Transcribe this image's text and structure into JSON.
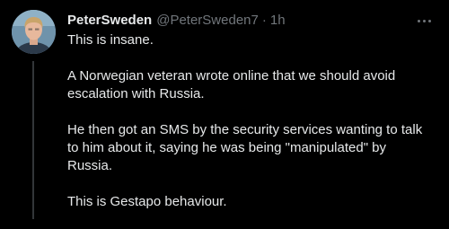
{
  "tweet": {
    "display_name": "PeterSweden",
    "handle": "@PeterSweden7",
    "separator": "·",
    "time": "1h",
    "avatar_icon": "avatar-photo",
    "more_icon": "more-horizontal-icon",
    "paragraphs": [
      "This is insane.",
      "A Norwegian veteran wrote online that we should avoid escalation with Russia.",
      "He then got an SMS by the security services wanting to talk to him about it, saying he was being \"manipulated\" by Russia.",
      "This is Gestapo behaviour."
    ]
  },
  "colors": {
    "background": "#000000",
    "primary_text": "#e7e9ea",
    "secondary_text": "#71767b",
    "thread_line": "#333639"
  }
}
